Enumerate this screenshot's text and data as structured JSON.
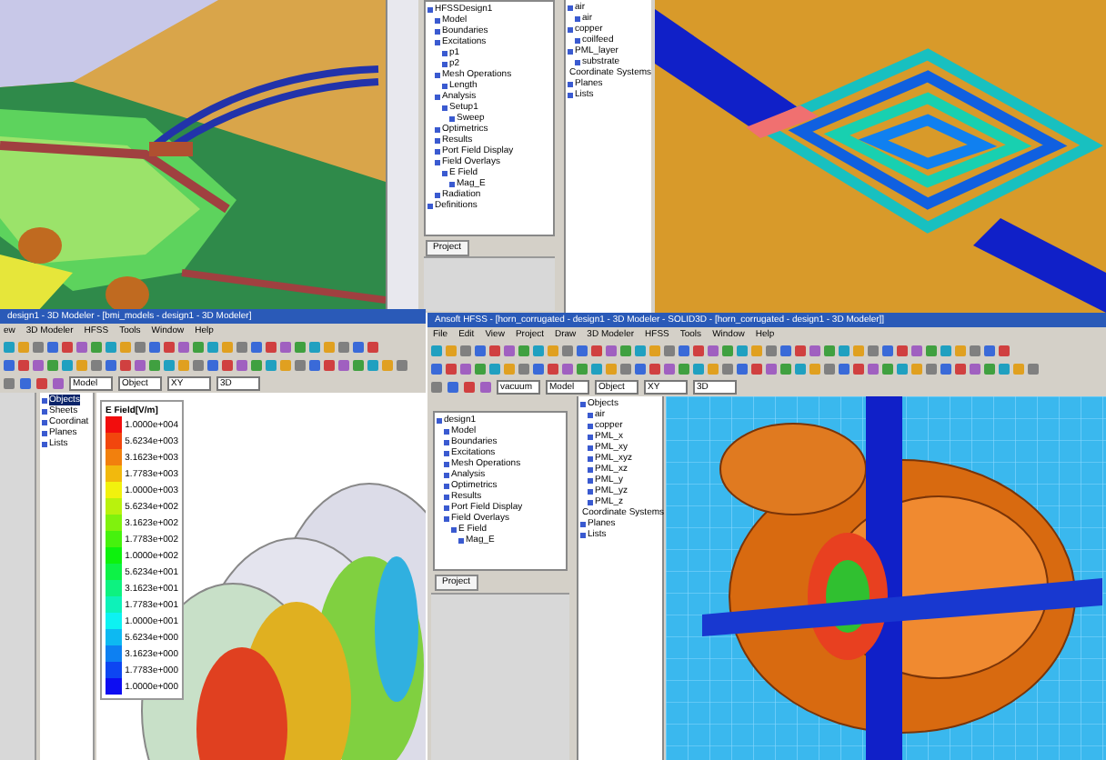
{
  "top_panel": {
    "project_tree": [
      {
        "label": "HFSSDesign1",
        "children": [
          {
            "label": "Model"
          },
          {
            "label": "Boundaries"
          },
          {
            "label": "Excitations",
            "children": [
              {
                "label": "p1"
              },
              {
                "label": "p2"
              }
            ]
          },
          {
            "label": "Mesh Operations",
            "children": [
              {
                "label": "Length"
              }
            ]
          },
          {
            "label": "Analysis",
            "children": [
              {
                "label": "Setup1",
                "children": [
                  {
                    "label": "Sweep"
                  }
                ]
              }
            ]
          },
          {
            "label": "Optimetrics"
          },
          {
            "label": "Results"
          },
          {
            "label": "Port Field Display"
          },
          {
            "label": "Field Overlays",
            "children": [
              {
                "label": "E Field",
                "children": [
                  {
                    "label": "Mag_E"
                  }
                ]
              }
            ]
          },
          {
            "label": "Radiation"
          }
        ]
      },
      {
        "label": "Definitions"
      }
    ],
    "tab": "Project",
    "object_tree": [
      {
        "label": "air",
        "children": [
          {
            "label": "air"
          }
        ]
      },
      {
        "label": "copper",
        "children": [
          {
            "label": "coilfeed"
          }
        ]
      },
      {
        "label": "PML_layer",
        "children": [
          {
            "label": "substrate"
          }
        ]
      },
      {
        "label": "Coordinate Systems"
      },
      {
        "label": "Planes"
      },
      {
        "label": "Lists"
      }
    ]
  },
  "left_window": {
    "title": "design1 - 3D Modeler - [bmi_models - design1 - 3D Modeler]",
    "menu": [
      "ew",
      "3D Modeler",
      "HFSS",
      "Tools",
      "Window",
      "Help"
    ],
    "dropdowns": [
      "Model",
      "Object",
      "XY",
      "3D"
    ],
    "object_tree": [
      {
        "label": "Objects",
        "selected": true
      },
      {
        "label": "Sheets",
        "selected": false
      },
      {
        "label": "Coordinat",
        "selected": false
      },
      {
        "label": "Planes",
        "selected": false
      },
      {
        "label": "Lists",
        "selected": false
      }
    ],
    "legend": {
      "title": "E Field[V/m]",
      "values": [
        "1.0000e+004",
        "5.6234e+003",
        "3.1623e+003",
        "1.7783e+003",
        "1.0000e+003",
        "5.6234e+002",
        "3.1623e+002",
        "1.7783e+002",
        "1.0000e+002",
        "5.6234e+001",
        "3.1623e+001",
        "1.7783e+001",
        "1.0000e+001",
        "5.6234e+000",
        "3.1623e+000",
        "1.7783e+000",
        "1.0000e+000"
      ]
    }
  },
  "right_window": {
    "title": "Ansoft HFSS - [horn_corrugated - design1 - 3D Modeler - SOLID3D - [horn_corrugated - design1 - 3D Modeler]]",
    "menu": [
      "File",
      "Edit",
      "View",
      "Project",
      "Draw",
      "3D Modeler",
      "HFSS",
      "Tools",
      "Window",
      "Help"
    ],
    "dropdowns": [
      "vacuum",
      "Model",
      "Object",
      "XY",
      "3D"
    ],
    "project_tree": [
      {
        "label": "design1",
        "children": [
          {
            "label": "Model"
          },
          {
            "label": "Boundaries"
          },
          {
            "label": "Excitations"
          },
          {
            "label": "Mesh Operations"
          },
          {
            "label": "Analysis"
          },
          {
            "label": "Optimetrics"
          },
          {
            "label": "Results"
          },
          {
            "label": "Port Field Display"
          },
          {
            "label": "Field Overlays",
            "children": [
              {
                "label": "E Field",
                "children": [
                  {
                    "label": "Mag_E"
                  }
                ]
              }
            ]
          }
        ]
      }
    ],
    "tab": "Project",
    "object_tree": [
      {
        "label": "Objects",
        "children": [
          {
            "label": "air"
          },
          {
            "label": "copper"
          },
          {
            "label": "PML_x"
          },
          {
            "label": "PML_xy"
          },
          {
            "label": "PML_xyz"
          },
          {
            "label": "PML_xz"
          },
          {
            "label": "PML_y"
          },
          {
            "label": "PML_yz"
          },
          {
            "label": "PML_z"
          }
        ]
      },
      {
        "label": "Coordinate Systems"
      },
      {
        "label": "Planes"
      },
      {
        "label": "Lists"
      }
    ]
  }
}
